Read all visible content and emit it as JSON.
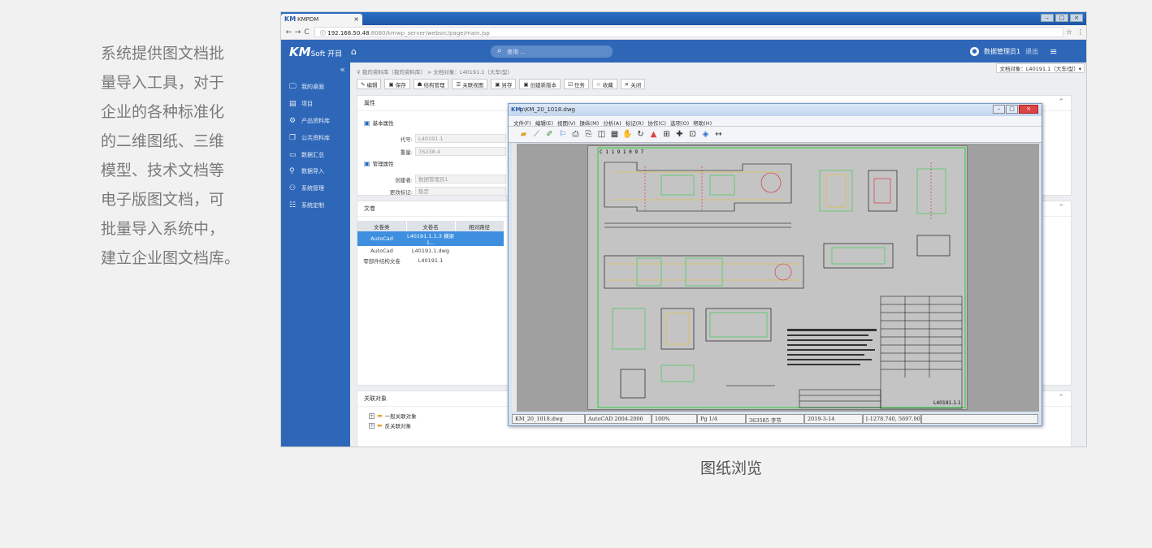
{
  "intro": {
    "lines": [
      "系统提供图文档批",
      "量导入工具，对于",
      "企业的各种标准化",
      "的二维图纸、三维",
      "模型、技术文档等",
      "电子版图文档，可",
      "批量导入系统中，",
      "建立企业图文档库。"
    ]
  },
  "caption": "图纸浏览",
  "browser": {
    "tab_title": "KMPDM",
    "tab_close": "×",
    "url_host": "192.168.50.48",
    "url_path": ":8080/kmwp_server/websrc/page/main.jsp",
    "back": "←",
    "forward": "→",
    "reload": "C",
    "star": "☆",
    "more": "⋮"
  },
  "app": {
    "brand": "KM",
    "brand_sub": "Soft 开目",
    "search_placeholder": "查询 ...",
    "user_name": "数据管理员1",
    "logout": "退出"
  },
  "sidebar": {
    "items": [
      {
        "icon": "🖵",
        "label": "我的桌面"
      },
      {
        "icon": "▤",
        "label": "项目"
      },
      {
        "icon": "⚙",
        "label": "产品资料库"
      },
      {
        "icon": "❐",
        "label": "公共资料库"
      },
      {
        "icon": "▭",
        "label": "数据汇总"
      },
      {
        "icon": "⚲",
        "label": "数据导入"
      },
      {
        "icon": "⚇",
        "label": "系统管理"
      },
      {
        "icon": "☷",
        "label": "系统定制"
      }
    ]
  },
  "main": {
    "breadcrumb": "我的资料库（我的资料库） > 文档对象：L40191.1（大车Ⅰ型）",
    "object_info": "文档对象：L40191.1（大车Ⅰ型）▾",
    "toolbar": [
      "编辑",
      "保存",
      "结构管理",
      "关联视图",
      "另存",
      "创建新版本",
      "任务",
      "收藏",
      "关闭"
    ],
    "properties": {
      "title": "属性",
      "basic_section": "基本属性",
      "mgmt_section": "管理属性",
      "fields": [
        {
          "label": "代号:",
          "value": "L40191.1"
        },
        {
          "label": "重量:",
          "value": "76238.4"
        },
        {
          "label": "创建者:",
          "value": "数据管理员1"
        },
        {
          "label": "更改标记:",
          "value": "稳定"
        }
      ]
    },
    "docs": {
      "title": "文卷",
      "headers": [
        "文卷类",
        "文卷名",
        "相对路径"
      ],
      "rows": [
        [
          "AutoCad",
          "L40191.1.1.3 横梁1...",
          ""
        ],
        [
          "AutoCad",
          "L40191.1.dwg",
          ""
        ],
        [
          "零部件结构文卷",
          "L40191.1",
          ""
        ]
      ]
    },
    "related": {
      "title": "关联对象",
      "items": [
        "一般关联对象",
        "反关联对象"
      ]
    }
  },
  "cad": {
    "title": "p\\KM_20_1018.dwg",
    "menu": [
      "文件(F)",
      "编辑(E)",
      "视图(V)",
      "操纵(M)",
      "分析(A)",
      "标记(R)",
      "协作(C)",
      "选项(O)",
      "帮助(H)"
    ],
    "status": [
      "KM_20_1018.dwg",
      "AutoCAD 2004-2006",
      "100%",
      "Pg 1/4",
      "363585 字节",
      "2019-3-14",
      "[-1278.740, 5697.904]"
    ],
    "sheet_label": "C 1 1 9 1 0 9 7",
    "title_block": "L40191.1.1"
  }
}
